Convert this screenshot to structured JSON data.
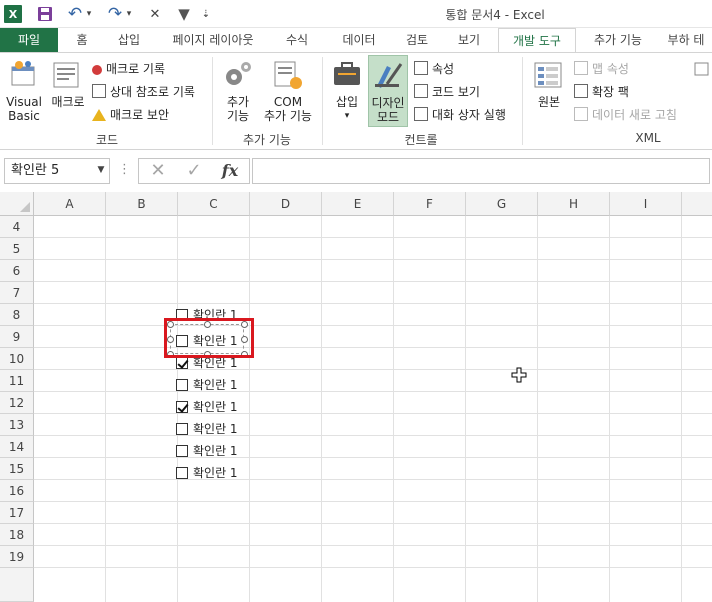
{
  "window": {
    "title": "통합 문서4 - Excel"
  },
  "quick_access": {
    "excel_logo": "X",
    "undo": "↶",
    "redo": "↷",
    "dropdown": "▾",
    "close": "✕",
    "filter": "▼",
    "customize": "⇣"
  },
  "tabs": [
    "파일",
    "홈",
    "삽입",
    "페이지 레이아웃",
    "수식",
    "데이터",
    "검토",
    "보기",
    "개발 도구",
    "추가 기능",
    "부하 테"
  ],
  "ribbon": {
    "code": {
      "label": "코드",
      "visual_basic_line1": "Visual",
      "visual_basic_line2": "Basic",
      "macro": "매크로",
      "record_macro": "매크로 기록",
      "relative_ref": "상대 참조로 기록",
      "macro_security": "매크로 보안"
    },
    "addins": {
      "label": "추가 기능",
      "addins_line1": "추가",
      "addins_line2": "기능",
      "com_line1": "COM",
      "com_line2": "추가 기능"
    },
    "controls": {
      "label": "컨트롤",
      "insert": "삽입",
      "design_mode_line1": "디자인",
      "design_mode_line2": "모드",
      "properties": "속성",
      "view_code": "코드 보기",
      "run_dialog": "대화 상자 실행"
    },
    "xml": {
      "label": "XML",
      "source": "원본",
      "map_properties": "맵 속성",
      "expansion_packs": "확장 팩",
      "refresh_data": "데이터 새로 고침"
    }
  },
  "formula_bar": {
    "name_box": "확인란 5",
    "cancel": "✕",
    "enter": "✓",
    "fx": "fx",
    "value": ""
  },
  "columns": [
    "A",
    "B",
    "C",
    "D",
    "E",
    "F",
    "G",
    "H",
    "I"
  ],
  "rows": [
    "4",
    "5",
    "6",
    "7",
    "8",
    "9",
    "10",
    "11",
    "12",
    "13",
    "14",
    "15",
    "16",
    "17",
    "18",
    "19"
  ],
  "checkboxes": [
    {
      "label": "확인란 1",
      "checked": false,
      "row": "8"
    },
    {
      "label": "확인란 1",
      "checked": false,
      "row": "9",
      "selected": true
    },
    {
      "label": "확인란 1",
      "checked": true,
      "row": "10"
    },
    {
      "label": "확인란 1",
      "checked": false,
      "row": "11"
    },
    {
      "label": "확인란 1",
      "checked": true,
      "row": "12"
    },
    {
      "label": "확인란 1",
      "checked": false,
      "row": "13"
    },
    {
      "label": "확인란 1",
      "checked": false,
      "row": "14"
    },
    {
      "label": "확인란 1",
      "checked": false,
      "row": "15"
    }
  ],
  "colors": {
    "excel_green": "#217346",
    "highlight_red": "#d9181f",
    "design_mode_active": "#c5dfc9"
  }
}
